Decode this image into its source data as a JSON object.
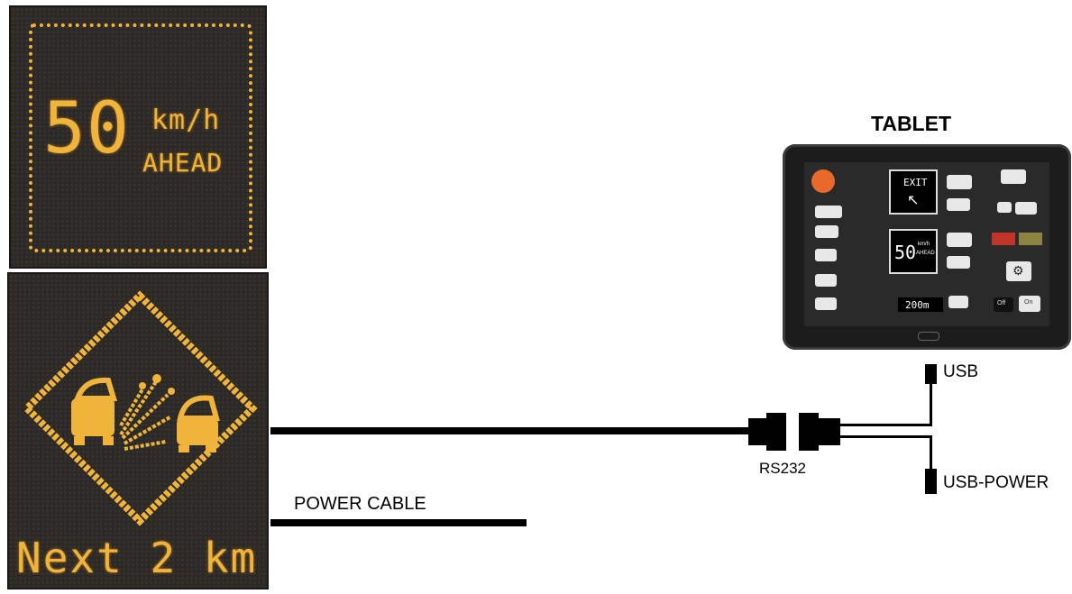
{
  "sign_top": {
    "speed": "50",
    "unit": "km/h",
    "message": "AHEAD"
  },
  "sign_bottom": {
    "caption": "Next 2 km"
  },
  "labels": {
    "tablet": "TABLET",
    "usb": "USB",
    "usb_power": "USB-POWER",
    "rs232": "RS232",
    "power_cable": "POWER CABLE"
  },
  "tablet_screen": {
    "exit_text": "EXIT",
    "speed": "50",
    "speed_unit": "km/h",
    "speed_msg": "AHEAD",
    "distance": "200m",
    "off_label": "Off",
    "on_label": "On"
  },
  "colors": {
    "led_amber": "#f0b43a",
    "panel_dark": "#2c2926",
    "cable": "#000000",
    "tablet_bezel": "#1c1c1c",
    "accent_red": "#c0342a",
    "accent_olive": "#8a8440",
    "logo_orange": "#e8692a"
  }
}
